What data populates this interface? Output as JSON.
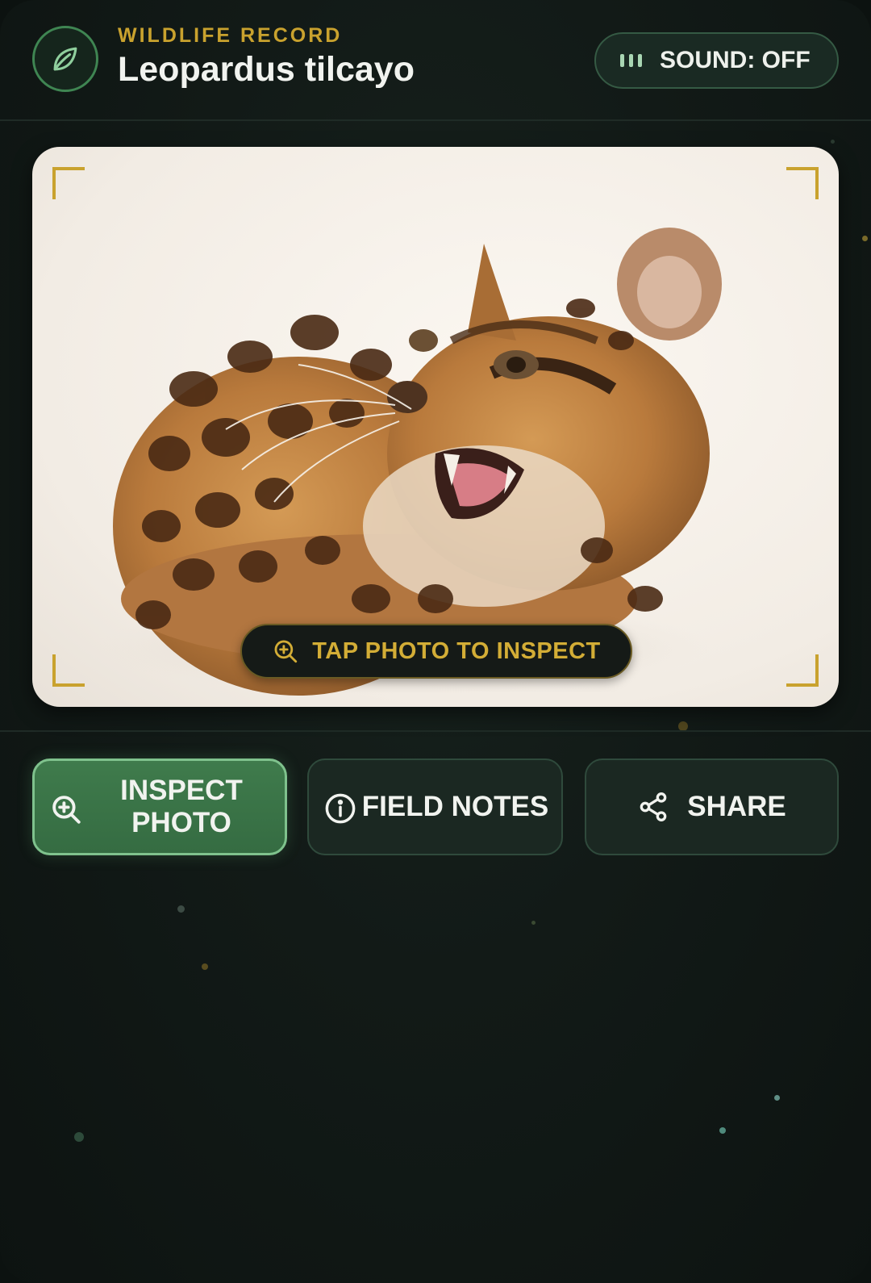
{
  "header": {
    "overline": "WILDLIFE RECORD",
    "title": "Leopardus tilcayo",
    "sound_label": "SOUND: OFF"
  },
  "photo": {
    "hint_label": "TAP PHOTO TO INSPECT",
    "hint_icon": "zoom-in-icon"
  },
  "actions": {
    "inspect_label": "INSPECT PHOTO",
    "notes_label": "FIELD NOTES",
    "share_label": "SHARE"
  },
  "colors": {
    "accent_gold": "#c9a22e",
    "accent_green": "#3f7b4c",
    "background": "#121a17"
  }
}
